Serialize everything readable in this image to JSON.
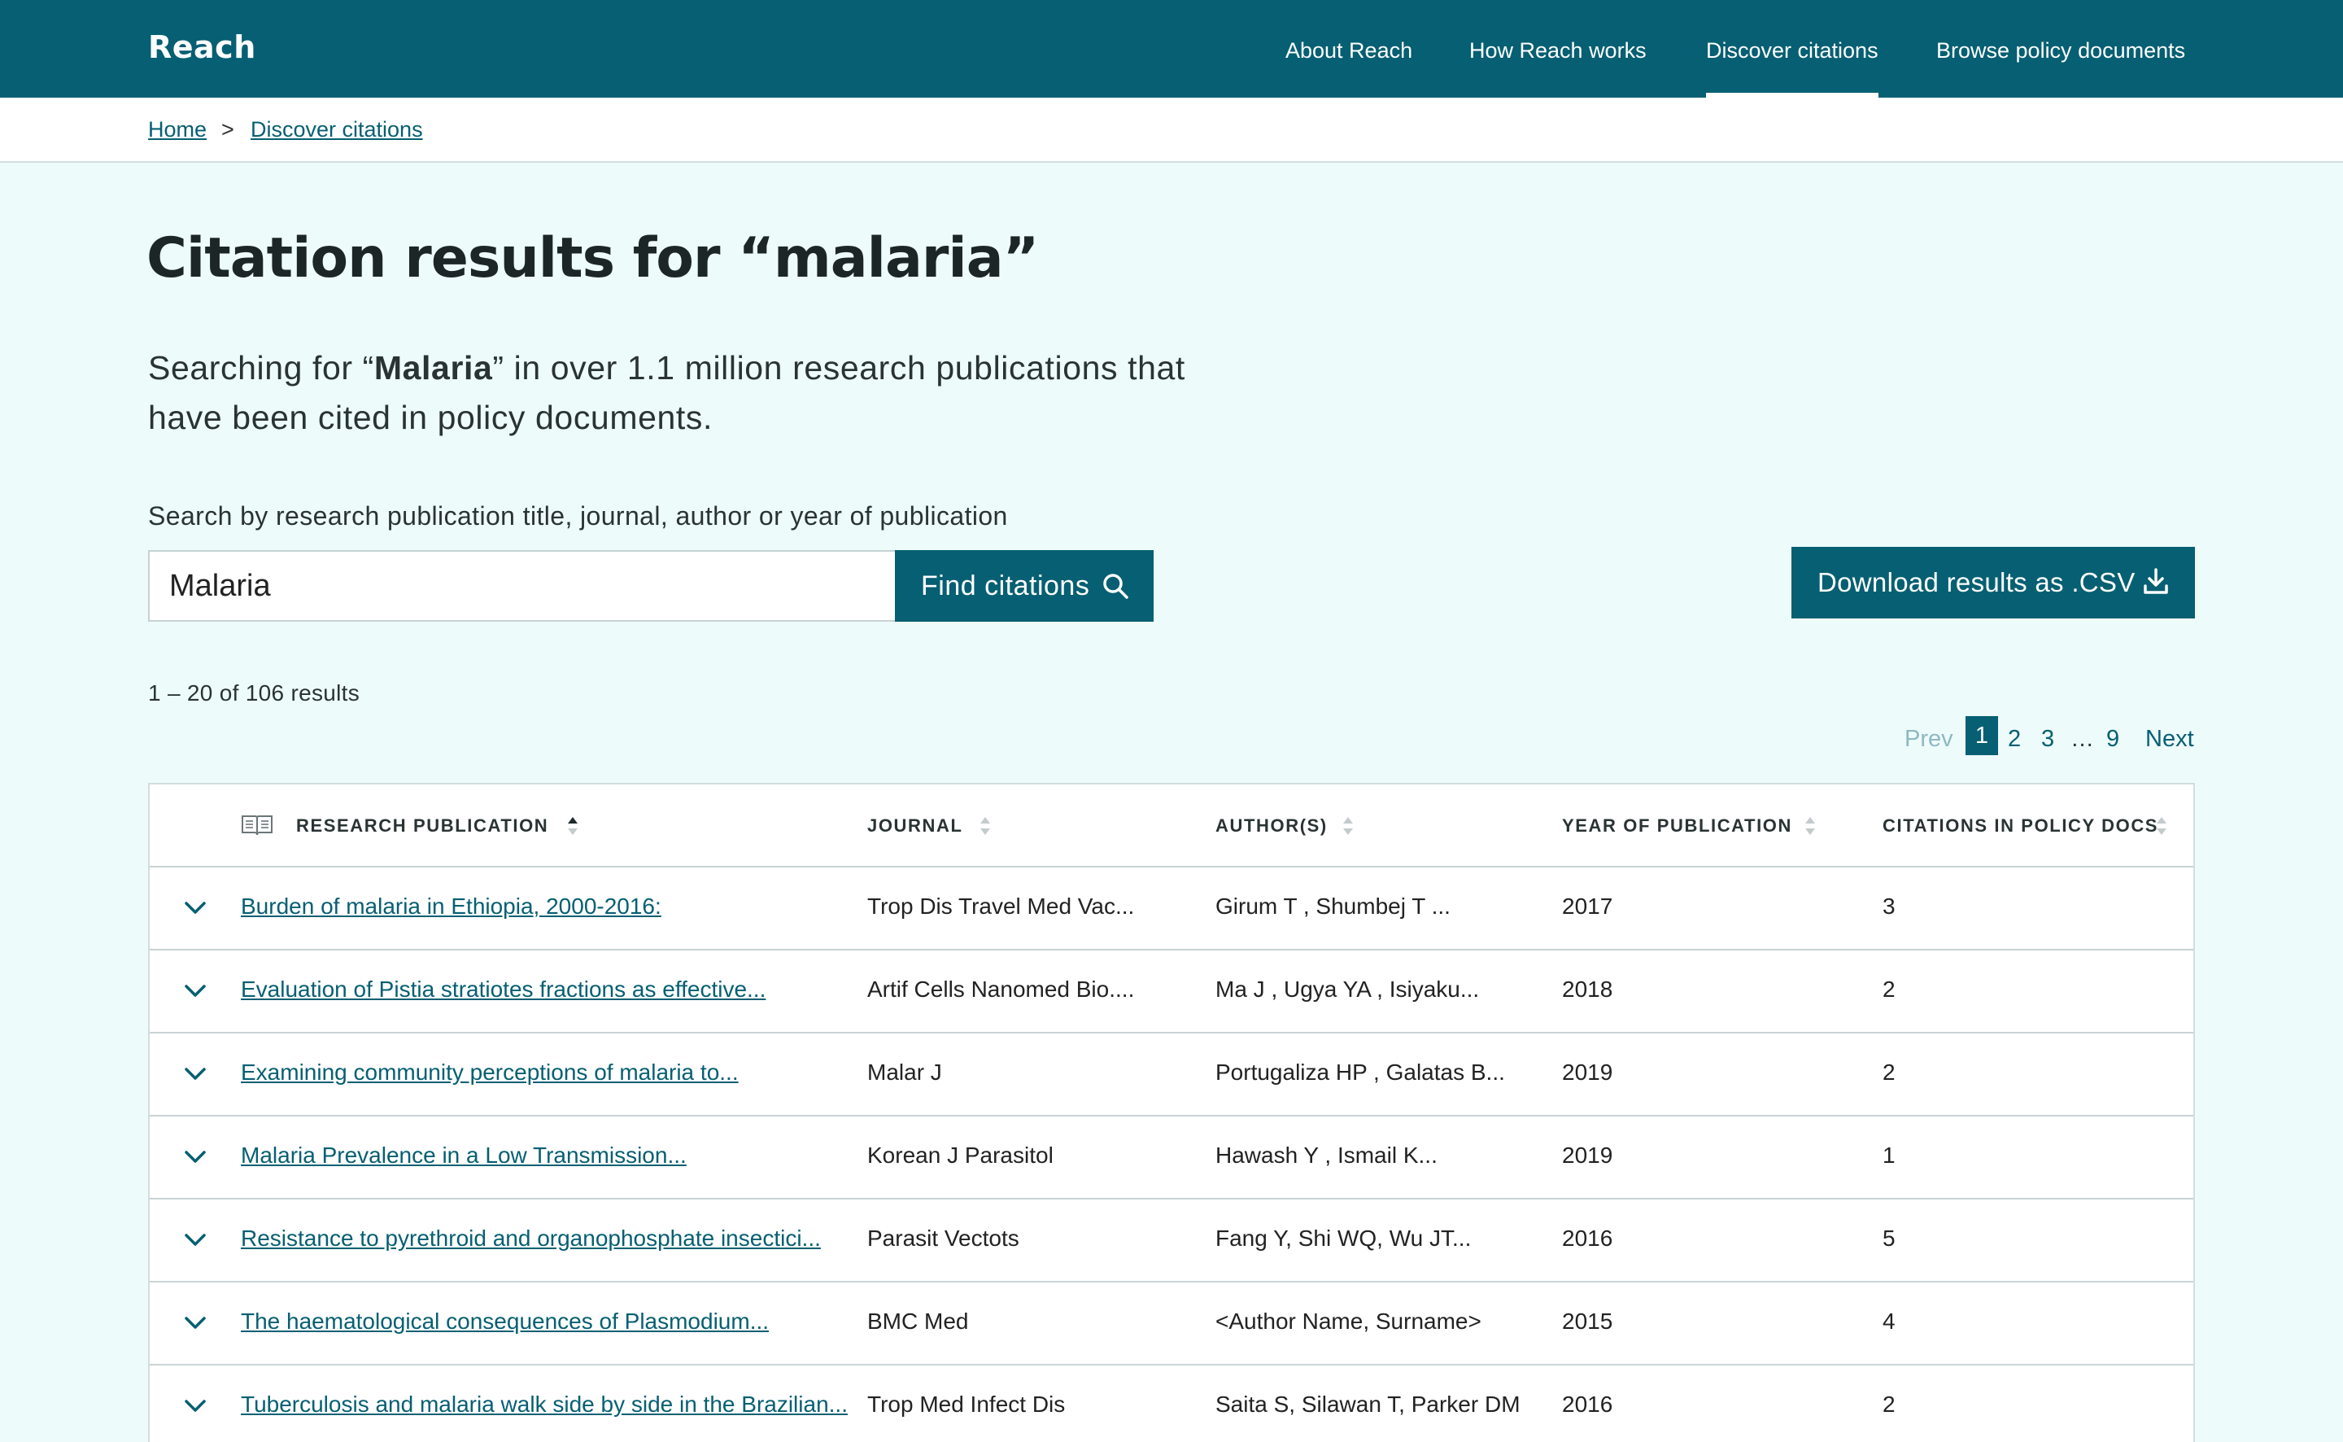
{
  "header": {
    "brand": "Reach",
    "nav": [
      {
        "label": "About Reach",
        "active": false
      },
      {
        "label": "How Reach works",
        "active": false
      },
      {
        "label": "Discover citations",
        "active": true
      },
      {
        "label": "Browse policy documents",
        "active": false
      }
    ]
  },
  "breadcrumb": {
    "items": [
      "Home",
      "Discover citations"
    ],
    "separator": ">"
  },
  "page": {
    "title": "Citation results for “malaria”",
    "intro_prefix": "Searching for “",
    "intro_term": "Malaria",
    "intro_suffix": "” in over 1.1 million research publications that have been cited in policy documents."
  },
  "search": {
    "label": "Search by research publication title, journal, author or year of publication",
    "value": "Malaria",
    "button_label": "Find citations",
    "button_icon": "search-icon"
  },
  "download": {
    "label": "Download results as .CSV",
    "icon": "download-icon"
  },
  "results": {
    "count_text": "1 – 20 of 106 results"
  },
  "pagination": {
    "prev": "Prev",
    "pages": [
      "1",
      "2",
      "3"
    ],
    "ellipsis": "…",
    "last": "9",
    "next": "Next",
    "current": "1"
  },
  "table": {
    "columns": [
      {
        "label": "RESEARCH PUBLICATION",
        "icon": "book-icon",
        "sorted": "asc"
      },
      {
        "label": "JOURNAL"
      },
      {
        "label": "AUTHOR(S)"
      },
      {
        "label": "YEAR OF PUBLICATION"
      },
      {
        "label": "CITATIONS IN POLICY DOCS"
      }
    ],
    "rows": [
      {
        "title": "Burden of malaria in Ethiopia, 2000-2016:",
        "journal": "Trop Dis Travel Med Vac...",
        "authors": "Girum T ,  Shumbej T ...",
        "year": "2017",
        "citations": "3"
      },
      {
        "title": "Evaluation of Pistia stratiotes fractions as effective...",
        "journal": "Artif Cells Nanomed Bio....",
        "authors": "Ma J ,  Ugya YA ,  Isiyaku...",
        "year": "2018",
        "citations": "2"
      },
      {
        "title": "Examining community perceptions of malaria to...",
        "journal": "Malar J",
        "authors": "Portugaliza HP ,  Galatas B...",
        "year": "2019",
        "citations": "2"
      },
      {
        "title": "Malaria Prevalence in a Low Transmission...",
        "journal": "Korean J Parasitol",
        "authors": "Hawash Y ,  Ismail K...",
        "year": "2019",
        "citations": "1"
      },
      {
        "title": "Resistance to pyrethroid and organophosphate insectici...",
        "journal": "Parasit Vectots",
        "authors": "Fang Y, Shi WQ, Wu JT...",
        "year": "2016",
        "citations": "5"
      },
      {
        "title": "The haematological consequences of Plasmodium...",
        "journal": "BMC Med",
        "authors": "<Author Name, Surname>",
        "year": "2015",
        "citations": "4"
      },
      {
        "title": "Tuberculosis and malaria walk side by side in the Brazilian...",
        "journal": "Trop Med Infect Dis",
        "authors": "Saita S, Silawan T, Parker DM",
        "year": "2016",
        "citations": "2"
      }
    ]
  },
  "colors": {
    "primary": "#065f72",
    "background": "#eefbfb",
    "text": "#1f2a2b"
  }
}
